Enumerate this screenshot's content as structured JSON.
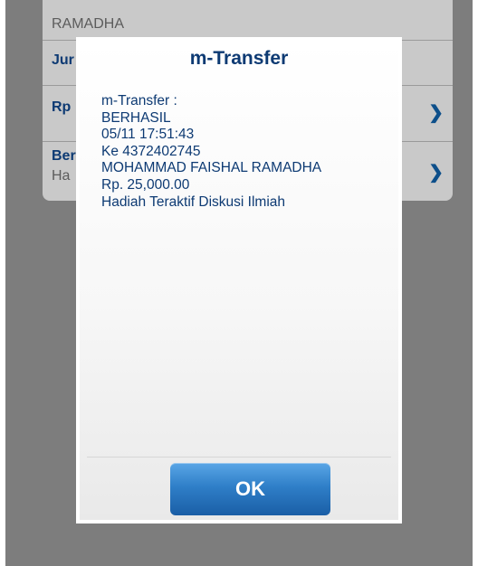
{
  "background_form": {
    "account_text": "RAMADHA",
    "amount_label": "Jur",
    "rp_label": "Rp",
    "description_label": "Ber",
    "description_value": "Ha",
    "chevron_icon": "chevron-right-icon"
  },
  "dialog": {
    "title": "m-Transfer",
    "lines": [
      "m-Transfer :",
      "BERHASIL",
      "05/11 17:51:43",
      "Ke 4372402745",
      "MOHAMMAD FAISHAL RAMADHA",
      "Rp. 25,000.00",
      "Hadiah Teraktif Diskusi Ilmiah"
    ],
    "ok_label": "OK"
  },
  "colors": {
    "accent": "#0d3a73",
    "button": "#2f7fc8",
    "overlay": "#7d7d7d"
  }
}
